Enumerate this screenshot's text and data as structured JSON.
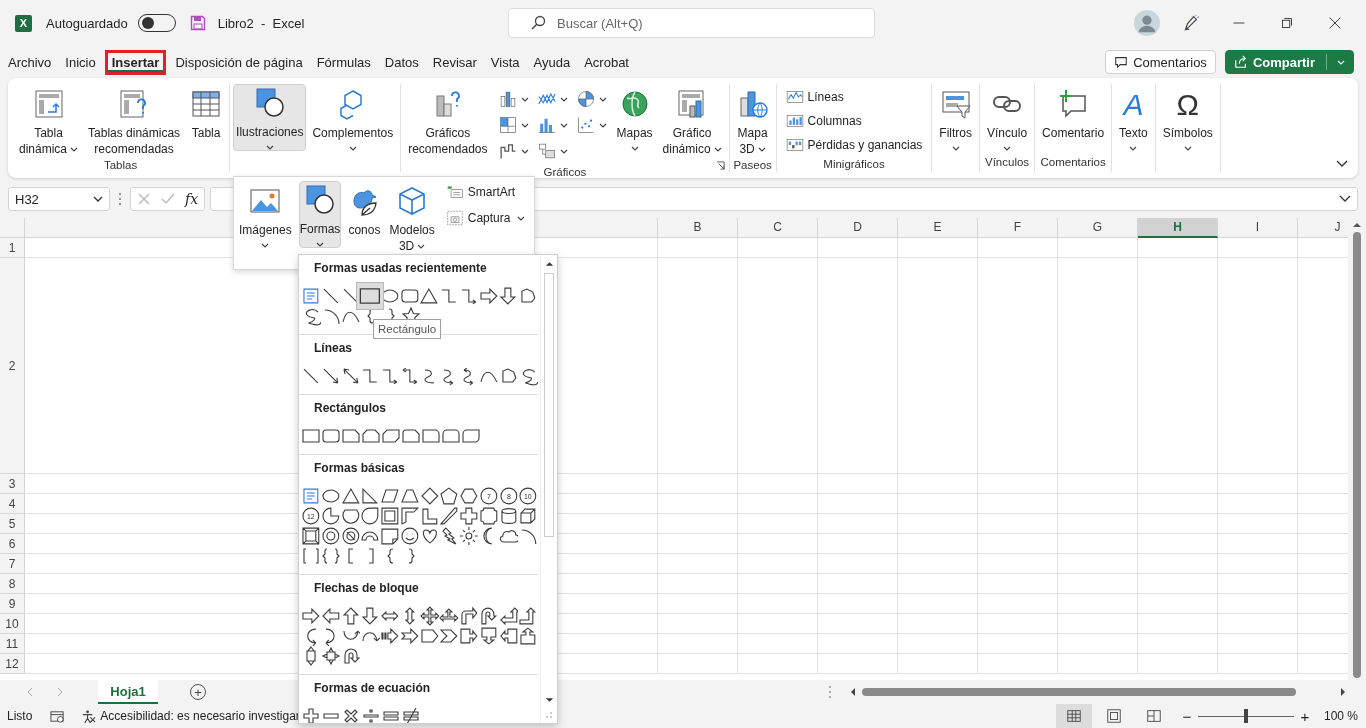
{
  "title_bar": {
    "logo": "X",
    "autosave_label": "Autoguardado",
    "autosave_on": false,
    "document": "Libro2  -  Excel",
    "search": {
      "placeholder": "Buscar (Alt+Q)"
    }
  },
  "tabs": [
    {
      "label": "Archivo",
      "selected": false,
      "marked": false
    },
    {
      "label": "Inicio",
      "selected": false,
      "marked": false
    },
    {
      "label": "Insertar",
      "selected": true,
      "marked": true
    },
    {
      "label": "Disposición de página",
      "selected": false,
      "marked": false
    },
    {
      "label": "Fórmulas",
      "selected": false,
      "marked": false
    },
    {
      "label": "Datos",
      "selected": false,
      "marked": false
    },
    {
      "label": "Revisar",
      "selected": false,
      "marked": false
    },
    {
      "label": "Vista",
      "selected": false,
      "marked": false
    },
    {
      "label": "Ayuda",
      "selected": false,
      "marked": false
    },
    {
      "label": "Acrobat",
      "selected": false,
      "marked": false
    }
  ],
  "header_buttons": [
    {
      "kind": "comments",
      "label": "Comentarios"
    },
    {
      "kind": "share",
      "label": "Compartir"
    }
  ],
  "ribbon": {
    "groups": [
      {
        "label": "Tablas",
        "items": [
          {
            "kind": "pivot",
            "lines": [
              "Tabla",
              "dinámica"
            ],
            "dropdown": true,
            "expanded": false
          },
          {
            "kind": "recpivot",
            "lines": [
              "Tablas dinámicas",
              "recomendadas"
            ],
            "dropdown": false,
            "expanded": false
          },
          {
            "kind": "table",
            "lines": [
              "Tabla"
            ],
            "dropdown": false,
            "expanded": false
          }
        ]
      },
      {
        "items": [
          {
            "kind": "illustrations",
            "lines": [
              "Ilustraciones"
            ],
            "dropdown": true,
            "expanded": true,
            "marked": true
          },
          {
            "kind": "addins",
            "lines": [
              "Complementos"
            ],
            "dropdown": true,
            "expanded": false
          }
        ]
      },
      {
        "label": "Gráficos",
        "launcher": true,
        "items": [
          {
            "kind": "recchart",
            "lines": [
              "Gráficos",
              "recomendados"
            ],
            "dropdown": false,
            "expanded": false
          },
          {
            "kind": "grid",
            "buttons": [
              {
                "kind": "column-chart"
              },
              {
                "kind": "hierarchy-chart"
              },
              {
                "kind": "waterfall-chart"
              },
              {
                "kind": "line-chart"
              },
              {
                "kind": "stat-chart"
              },
              {
                "kind": "combo-chart"
              },
              {
                "kind": "pie-chart"
              },
              {
                "kind": "scatter-chart"
              }
            ]
          },
          {
            "kind": "globe",
            "lines": [
              "Mapas"
            ],
            "dropdown": true,
            "expanded": false
          },
          {
            "kind": "pivotchart",
            "lines": [
              "Gráfico",
              "dinámico"
            ],
            "dropdown": true,
            "expanded": false
          }
        ]
      },
      {
        "label": "Paseos",
        "items": [
          {
            "kind": "map3d",
            "lines": [
              "Mapa",
              "3D"
            ],
            "dropdown": true,
            "expanded": false
          }
        ]
      },
      {
        "label": "Minigráficos",
        "items": [
          {
            "kind": "list",
            "entries": [
              {
                "kind": "spark-line",
                "label": "Líneas"
              },
              {
                "kind": "spark-column",
                "label": "Columnas"
              },
              {
                "kind": "spark-winloss",
                "label": "Pérdidas y ganancias"
              }
            ]
          }
        ]
      },
      {
        "items": [
          {
            "kind": "filters",
            "lines": [
              "Filtros"
            ],
            "dropdown": true,
            "expanded": false
          }
        ]
      },
      {
        "label": "Vínculos",
        "items": [
          {
            "kind": "link",
            "lines": [
              "Vínculo"
            ],
            "dropdown": true,
            "expanded": false
          }
        ]
      },
      {
        "label": "Comentarios",
        "items": [
          {
            "kind": "comment",
            "lines": [
              "Comentario"
            ],
            "dropdown": false,
            "expanded": false
          }
        ]
      },
      {
        "items": [
          {
            "kind": "text",
            "glyph": "A",
            "lines": [
              "Texto"
            ],
            "dropdown": true,
            "expanded": false
          }
        ]
      },
      {
        "items": [
          {
            "kind": "symbols",
            "glyph": "Ω",
            "lines": [
              "Símbolos"
            ],
            "dropdown": true,
            "expanded": false
          }
        ]
      }
    ]
  },
  "illustrations_menu": {
    "items": [
      {
        "kind": "images",
        "lines": [
          "Imágenes"
        ],
        "dropdown": true,
        "expanded": false
      },
      {
        "kind": "illustrations",
        "lines": [
          "Formas"
        ],
        "dropdown": true,
        "expanded": true,
        "marked": true
      },
      {
        "kind": "icons",
        "lines": [
          "conos"
        ],
        "dropdown": false,
        "expanded": false
      },
      {
        "kind": "cube",
        "lines": [
          "Modelos",
          "3D"
        ],
        "dropdown": true,
        "expanded": false
      }
    ],
    "small_items": [
      {
        "kind": "smartart",
        "label": "SmartArt",
        "dropdown": false
      },
      {
        "kind": "screenshot",
        "label": "Captura",
        "dropdown": true
      }
    ]
  },
  "shapes_gallery": {
    "tooltip": "Rectángulo",
    "sections": [
      {
        "title": "Formas usadas recientemente",
        "rows": [
          [
            {
              "kind": "textbox",
              "selected": false,
              "marked": false
            },
            {
              "kind": "line",
              "selected": false,
              "marked": false
            },
            {
              "kind": "line",
              "selected": false,
              "marked": false
            },
            {
              "kind": "rectangle",
              "selected": true,
              "marked": true
            },
            {
              "kind": "oval",
              "selected": false,
              "marked": false
            },
            {
              "kind": "rounded-rectangle",
              "selected": false,
              "marked": false
            },
            {
              "kind": "triangle",
              "selected": false,
              "marked": false
            },
            {
              "kind": "elbow-connector",
              "selected": false,
              "marked": false
            },
            {
              "kind": "elbow-arrow",
              "selected": false,
              "marked": false
            },
            {
              "kind": "right-arrow",
              "selected": false,
              "marked": false
            },
            {
              "kind": "down-arrow",
              "selected": false,
              "marked": false
            },
            {
              "kind": "freeform",
              "selected": false,
              "marked": false
            }
          ],
          [
            {
              "kind": "scribble",
              "selected": false,
              "marked": false
            },
            {
              "kind": "arc",
              "selected": false,
              "marked": false
            },
            {
              "kind": "curve",
              "selected": false,
              "marked": false
            },
            {
              "kind": "left-brace",
              "selected": false,
              "marked": false
            },
            {
              "kind": "right-brace",
              "selected": false,
              "marked": false
            },
            {
              "kind": "star",
              "selected": false,
              "marked": false
            }
          ]
        ]
      },
      {
        "title": "Líneas",
        "rows": [
          [
            {
              "kind": "line"
            },
            {
              "kind": "arrow-line"
            },
            {
              "kind": "double-arrow-line"
            },
            {
              "kind": "elbow-connector"
            },
            {
              "kind": "elbow-arrow"
            },
            {
              "kind": "elbow-double-arrow"
            },
            {
              "kind": "curved-connector"
            },
            {
              "kind": "curved-arrow"
            },
            {
              "kind": "curved-double-arrow"
            },
            {
              "kind": "curve"
            },
            {
              "kind": "freeform"
            },
            {
              "kind": "scribble"
            }
          ]
        ]
      },
      {
        "title": "Rectángulos",
        "rows": [
          [
            {
              "kind": "rectangle"
            },
            {
              "kind": "rounded-rectangle"
            },
            {
              "kind": "snipped-rectangle"
            },
            {
              "kind": "double-snipped-rectangle"
            },
            {
              "kind": "diagonal-snipped-rectangle"
            },
            {
              "kind": "snip-round-rectangle"
            },
            {
              "kind": "one-round-rectangle"
            },
            {
              "kind": "two-round-rectangle"
            },
            {
              "kind": "diagonal-round-rectangle"
            }
          ]
        ]
      },
      {
        "title": "Formas básicas",
        "rows": [
          [
            {
              "kind": "textbox"
            },
            {
              "kind": "oval"
            },
            {
              "kind": "triangle"
            },
            {
              "kind": "right-triangle"
            },
            {
              "kind": "parallelogram"
            },
            {
              "kind": "trapezoid"
            },
            {
              "kind": "diamond"
            },
            {
              "kind": "pentagon"
            },
            {
              "kind": "hexagon"
            },
            {
              "kind": "numbered-circle",
              "label": "7"
            },
            {
              "kind": "numbered-circle",
              "label": "8"
            },
            {
              "kind": "numbered-circle",
              "label": "10"
            }
          ],
          [
            {
              "kind": "numbered-circle",
              "label": "12"
            },
            {
              "kind": "pie"
            },
            {
              "kind": "chord"
            },
            {
              "kind": "teardrop"
            },
            {
              "kind": "frame"
            },
            {
              "kind": "half-frame"
            },
            {
              "kind": "l-shape"
            },
            {
              "kind": "diagonal-stripe"
            },
            {
              "kind": "cross"
            },
            {
              "kind": "plaque"
            },
            {
              "kind": "can"
            },
            {
              "kind": "cube"
            }
          ],
          [
            {
              "kind": "bevel"
            },
            {
              "kind": "donut"
            },
            {
              "kind": "no-symbol"
            },
            {
              "kind": "block-arc"
            },
            {
              "kind": "folded-corner"
            },
            {
              "kind": "smiley"
            },
            {
              "kind": "heart"
            },
            {
              "kind": "lightning"
            },
            {
              "kind": "sun"
            },
            {
              "kind": "moon"
            },
            {
              "kind": "cloud"
            },
            {
              "kind": "arc"
            }
          ],
          [
            {
              "kind": "bracket-pair"
            },
            {
              "kind": "brace-pair"
            },
            {
              "kind": "left-bracket"
            },
            {
              "kind": "right-bracket"
            },
            {
              "kind": "left-brace"
            },
            {
              "kind": "right-brace"
            }
          ]
        ]
      },
      {
        "title": "Flechas de bloque",
        "rows": [
          [
            {
              "kind": "right-arrow"
            },
            {
              "kind": "left-arrow"
            },
            {
              "kind": "up-arrow"
            },
            {
              "kind": "down-arrow"
            },
            {
              "kind": "left-right-arrow"
            },
            {
              "kind": "up-down-arrow"
            },
            {
              "kind": "quad-arrow"
            },
            {
              "kind": "three-way-arrow"
            },
            {
              "kind": "bent-arrow"
            },
            {
              "kind": "u-turn-arrow"
            },
            {
              "kind": "left-up-arrow"
            },
            {
              "kind": "bent-up-arrow"
            }
          ],
          [
            {
              "kind": "curved-right-arrow"
            },
            {
              "kind": "curved-left-arrow"
            },
            {
              "kind": "curved-up-arrow"
            },
            {
              "kind": "curved-down-arrow"
            },
            {
              "kind": "striped-arrow"
            },
            {
              "kind": "notched-arrow"
            },
            {
              "kind": "pentagon-arrow"
            },
            {
              "kind": "chevron"
            },
            {
              "kind": "right-callout"
            },
            {
              "kind": "down-callout"
            },
            {
              "kind": "left-callout"
            },
            {
              "kind": "up-callout"
            }
          ],
          [
            {
              "kind": "up-down-callout"
            },
            {
              "kind": "quad-callout"
            },
            {
              "kind": "circular-arrow"
            }
          ]
        ]
      },
      {
        "title": "Formas de ecuación",
        "rows": [
          [
            {
              "kind": "plus"
            },
            {
              "kind": "minus"
            },
            {
              "kind": "multiply"
            },
            {
              "kind": "divide"
            },
            {
              "kind": "equal"
            },
            {
              "kind": "not-equal"
            }
          ]
        ]
      }
    ]
  },
  "formula_bar": {
    "name_box": "H32",
    "fx": "fx"
  },
  "sheet": {
    "columns": [
      {
        "label": "B",
        "selected": false
      },
      {
        "label": "C",
        "selected": false
      },
      {
        "label": "D",
        "selected": false
      },
      {
        "label": "E",
        "selected": false
      },
      {
        "label": "F",
        "selected": false
      },
      {
        "label": "G",
        "selected": false
      },
      {
        "label": "H",
        "selected": true
      },
      {
        "label": "I",
        "selected": false
      },
      {
        "label": "J",
        "selected": false
      }
    ],
    "rows": [
      {
        "label": "1",
        "kind": "normal"
      },
      {
        "label": "2",
        "kind": "tall"
      },
      {
        "label": "3",
        "kind": "normal"
      },
      {
        "label": "4",
        "kind": "normal"
      },
      {
        "label": "5",
        "kind": "normal"
      },
      {
        "label": "6",
        "kind": "normal"
      },
      {
        "label": "7",
        "kind": "normal"
      },
      {
        "label": "8",
        "kind": "normal"
      },
      {
        "label": "9",
        "kind": "normal"
      },
      {
        "label": "10",
        "kind": "normal"
      },
      {
        "label": "11",
        "kind": "normal"
      },
      {
        "label": "12",
        "kind": "normal"
      }
    ]
  },
  "sheet_tabs": [
    {
      "label": "Hoja1",
      "selected": true
    }
  ],
  "add_sheet": "+",
  "status_bar": {
    "ready": "Listo",
    "accessibility": "Accesibilidad: es necesario investigar",
    "views": [
      {
        "kind": "normal",
        "selected": true
      },
      {
        "kind": "page-layout",
        "selected": false
      },
      {
        "kind": "page-break",
        "selected": false
      }
    ],
    "zoom": {
      "minus": "−",
      "plus": "+",
      "level": 0.5,
      "reading": "100 %"
    }
  }
}
